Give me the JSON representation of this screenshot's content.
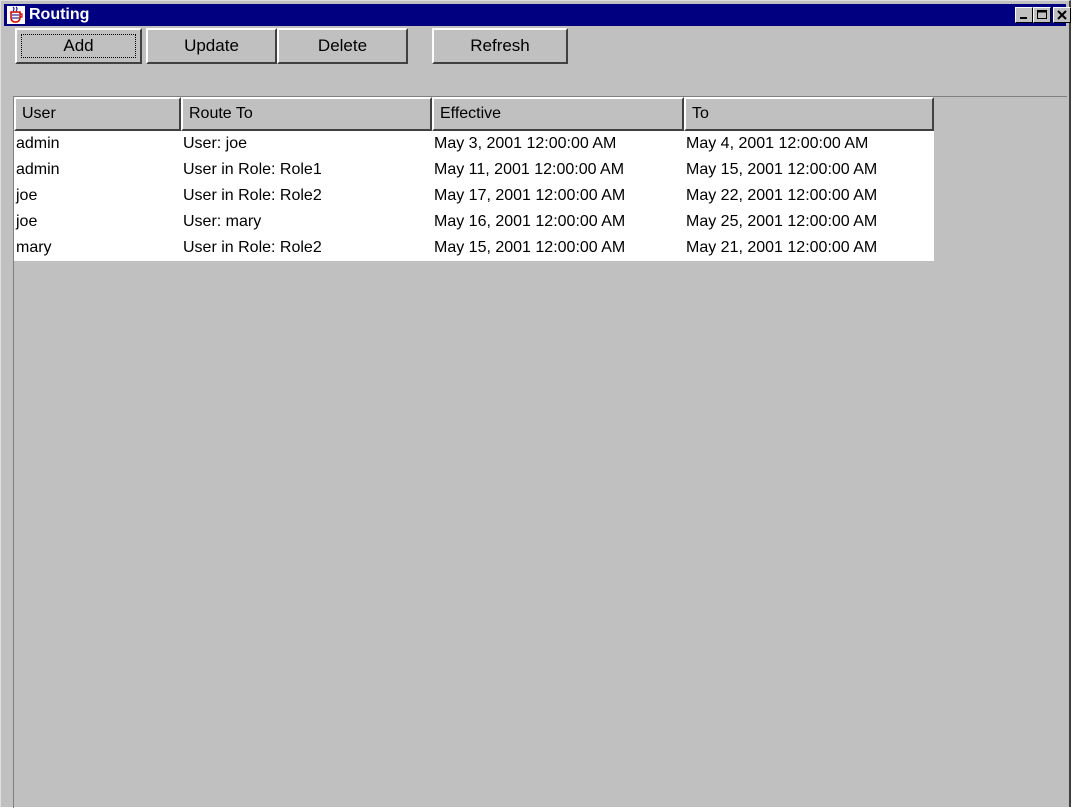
{
  "window": {
    "title": "Routing",
    "controls": [
      "minimize-icon",
      "maximize-icon",
      "close-icon"
    ],
    "title_bar_color": "#000080"
  },
  "toolbar": {
    "add_label": "Add",
    "update_label": "Update",
    "delete_label": "Delete",
    "refresh_label": "Refresh"
  },
  "table": {
    "columns": [
      "User",
      "Route To",
      "Effective",
      "To"
    ],
    "rows": [
      [
        "admin",
        "User: joe",
        "May 3, 2001 12:00:00 AM",
        "May 4, 2001 12:00:00 AM"
      ],
      [
        "admin",
        "User in Role: Role1",
        "May 11, 2001 12:00:00 AM",
        "May 15, 2001 12:00:00 AM"
      ],
      [
        "joe",
        "User in Role: Role2",
        "May 17, 2001 12:00:00 AM",
        "May 22, 2001 12:00:00 AM"
      ],
      [
        "joe",
        "User: mary",
        "May 16, 2001 12:00:00 AM",
        "May 25, 2001 12:00:00 AM"
      ],
      [
        "mary",
        "User in Role: Role2",
        "May 15, 2001 12:00:00 AM",
        "May 21, 2001 12:00:00 AM"
      ]
    ]
  }
}
